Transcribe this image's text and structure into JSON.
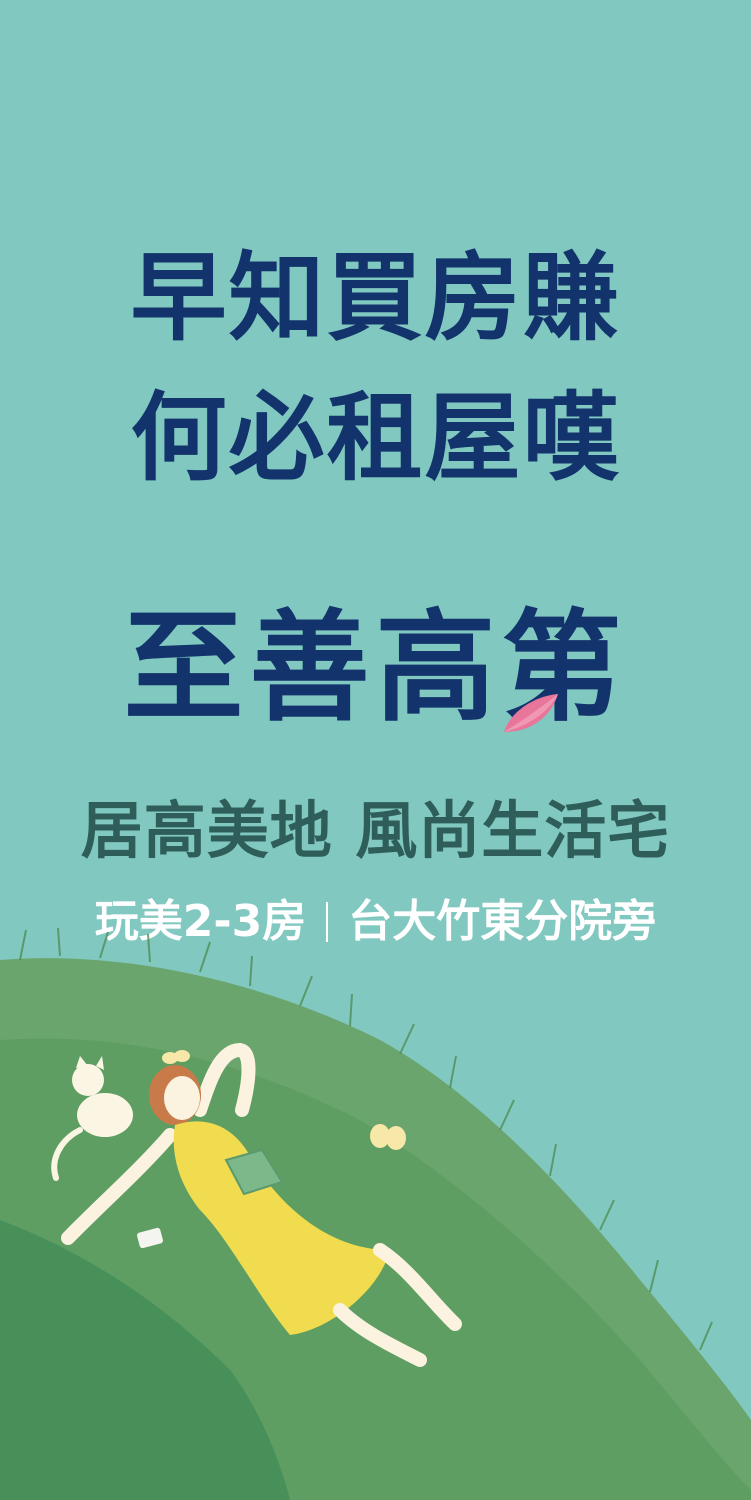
{
  "headline": {
    "line1": "早知買房賺",
    "line2": "何必租屋嘆"
  },
  "brand": {
    "name": "至善高第"
  },
  "tagline": "居高美地 風尚生活宅",
  "subline": {
    "left": "玩美2-3房",
    "right": "台大竹東分院旁"
  },
  "colors": {
    "background": "#80c8c0",
    "headline": "#12336b",
    "tagline": "#2f5e5a",
    "grass": "#5e9e62",
    "dress": "#f0dc4e",
    "petal": "#e8769a"
  },
  "illustration": {
    "subject": "woman-lying-on-grass-icon",
    "cat": "white-cat-icon",
    "butterfly": "butterfly-icon",
    "book": "book-icon",
    "phone": "music-player-icon"
  }
}
